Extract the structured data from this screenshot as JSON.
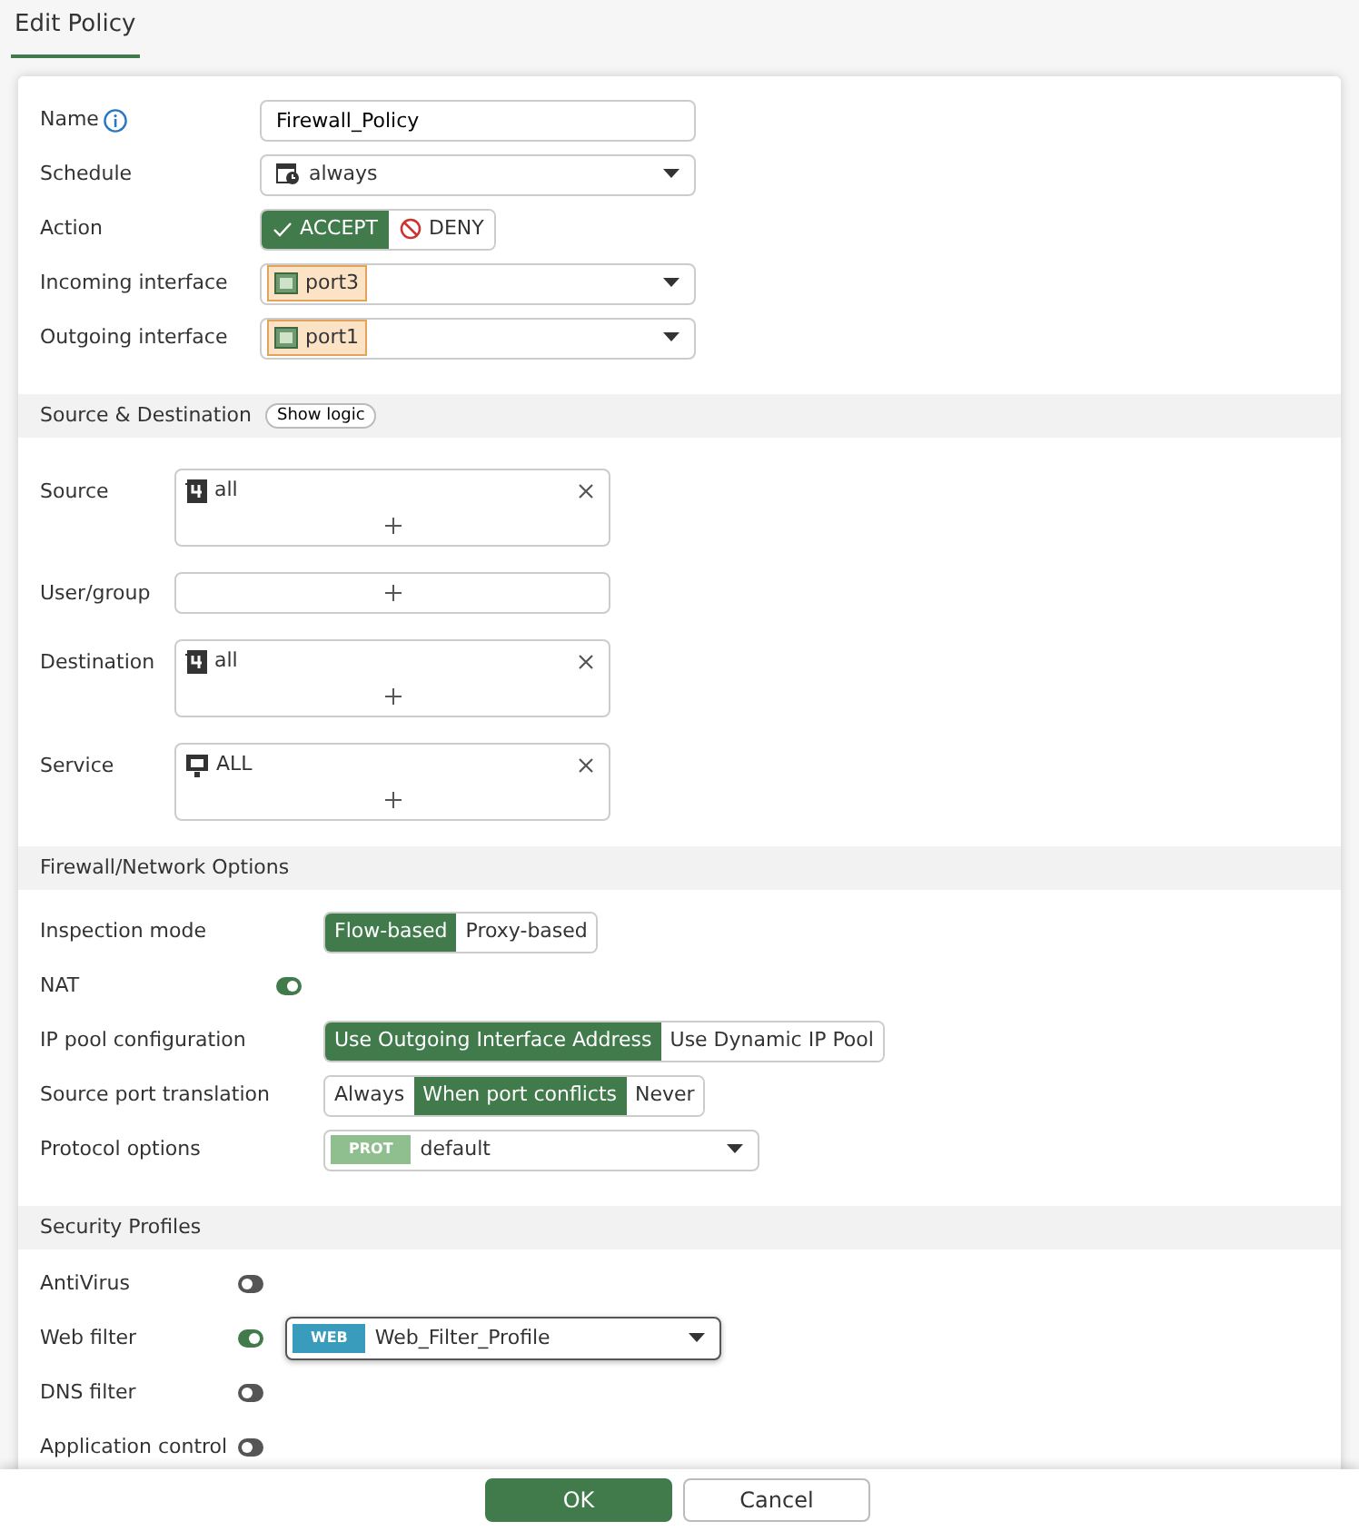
{
  "title": "Edit Policy",
  "sections": [
    {
      "rows": [
        {
          "kind": "text",
          "label": "Name",
          "info": true,
          "value": "Firewall_Policy"
        },
        {
          "kind": "select",
          "label": "Schedule",
          "value": "always"
        },
        {
          "kind": "segmented",
          "label": "Action",
          "options": [
            {
              "label": "ACCEPT",
              "selected": true
            },
            {
              "label": "DENY",
              "selected": false
            }
          ]
        },
        {
          "kind": "select",
          "label": "Incoming interface",
          "tag": "port3"
        },
        {
          "kind": "select",
          "label": "Outgoing interface",
          "tag": "port1"
        }
      ]
    },
    {
      "title": "Source & Destination",
      "button": "Show logic",
      "rows": [
        {
          "kind": "list",
          "label": "Source",
          "entries": [
            {
              "kind": "address",
              "label": "all"
            }
          ]
        },
        {
          "kind": "list",
          "label": "User/group",
          "entries": []
        },
        {
          "kind": "list",
          "label": "Destination",
          "entries": [
            {
              "kind": "address",
              "label": "all"
            }
          ]
        },
        {
          "kind": "list",
          "label": "Service",
          "entries": [
            {
              "kind": "service",
              "label": "ALL"
            }
          ]
        }
      ]
    },
    {
      "title": "Firewall/Network Options",
      "rows": [
        {
          "kind": "segmented",
          "label": "Inspection mode",
          "options": [
            {
              "label": "Flow-based",
              "selected": true
            },
            {
              "label": "Proxy-based",
              "selected": false
            }
          ]
        },
        {
          "kind": "toggle",
          "label": "NAT",
          "on": true
        },
        {
          "kind": "segmented",
          "label": "IP pool configuration",
          "options": [
            {
              "label": "Use Outgoing Interface Address",
              "selected": true
            },
            {
              "label": "Use Dynamic IP Pool",
              "selected": false
            }
          ]
        },
        {
          "kind": "segmented",
          "label": "Source port translation",
          "options": [
            {
              "label": "Always",
              "selected": false
            },
            {
              "label": "When port conflicts",
              "selected": true
            },
            {
              "label": "Never",
              "selected": false
            }
          ]
        },
        {
          "kind": "select",
          "label": "Protocol options",
          "badge": "PROT",
          "value": "default"
        }
      ]
    },
    {
      "title": "Security Profiles",
      "rows": [
        {
          "kind": "toggle",
          "label": "AntiVirus",
          "on": false
        },
        {
          "kind": "toggle",
          "label": "Web filter",
          "on": true,
          "select": {
            "badge": "WEB",
            "value": "Web_Filter_Profile"
          }
        },
        {
          "kind": "toggle",
          "label": "DNS filter",
          "on": false
        },
        {
          "kind": "toggle",
          "label": "Application control",
          "on": false
        }
      ]
    }
  ],
  "footer": [
    {
      "label": "OK",
      "primary": true
    },
    {
      "label": "Cancel",
      "primary": false
    }
  ]
}
